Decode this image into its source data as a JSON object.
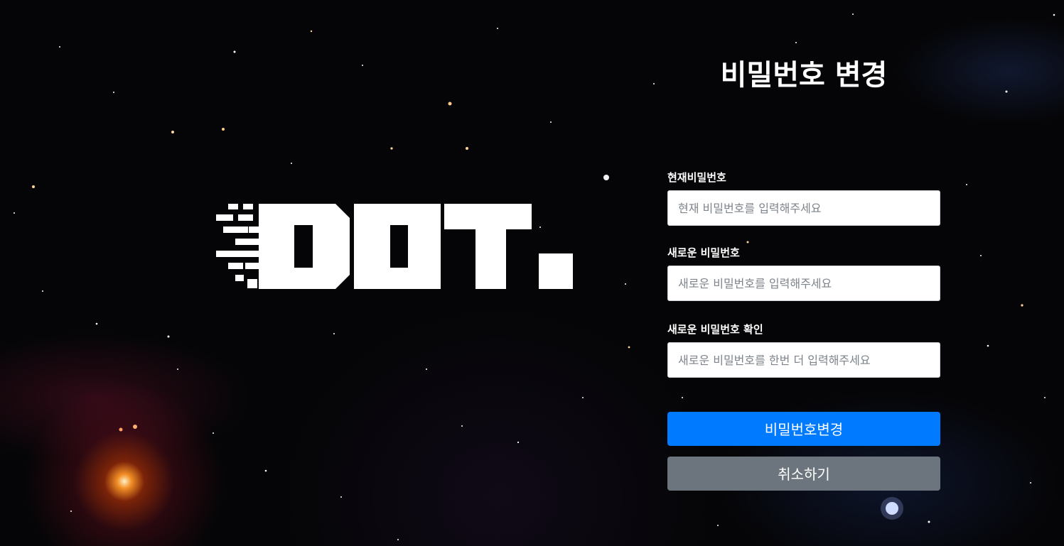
{
  "page": {
    "title": "비밀번호 변경",
    "logo_text": "DOT."
  },
  "form": {
    "current_password": {
      "label": "현재비밀번호",
      "placeholder": "현재 비밀번호를 입력해주세요",
      "value": ""
    },
    "new_password": {
      "label": "새로운 비밀번호",
      "placeholder": "새로운 비밀번호를 입력해주세요",
      "value": ""
    },
    "confirm_password": {
      "label": "새로운 비밀번호 확인",
      "placeholder": "새로운 비밀번호를 한번 더 입력해주세요",
      "value": ""
    }
  },
  "buttons": {
    "submit_label": "비밀번호변경",
    "cancel_label": "취소하기"
  },
  "colors": {
    "primary": "#007bff",
    "secondary": "#6c757d",
    "text": "#ffffff",
    "background": "#050507"
  },
  "icons": {
    "logo": "dot-logo"
  }
}
